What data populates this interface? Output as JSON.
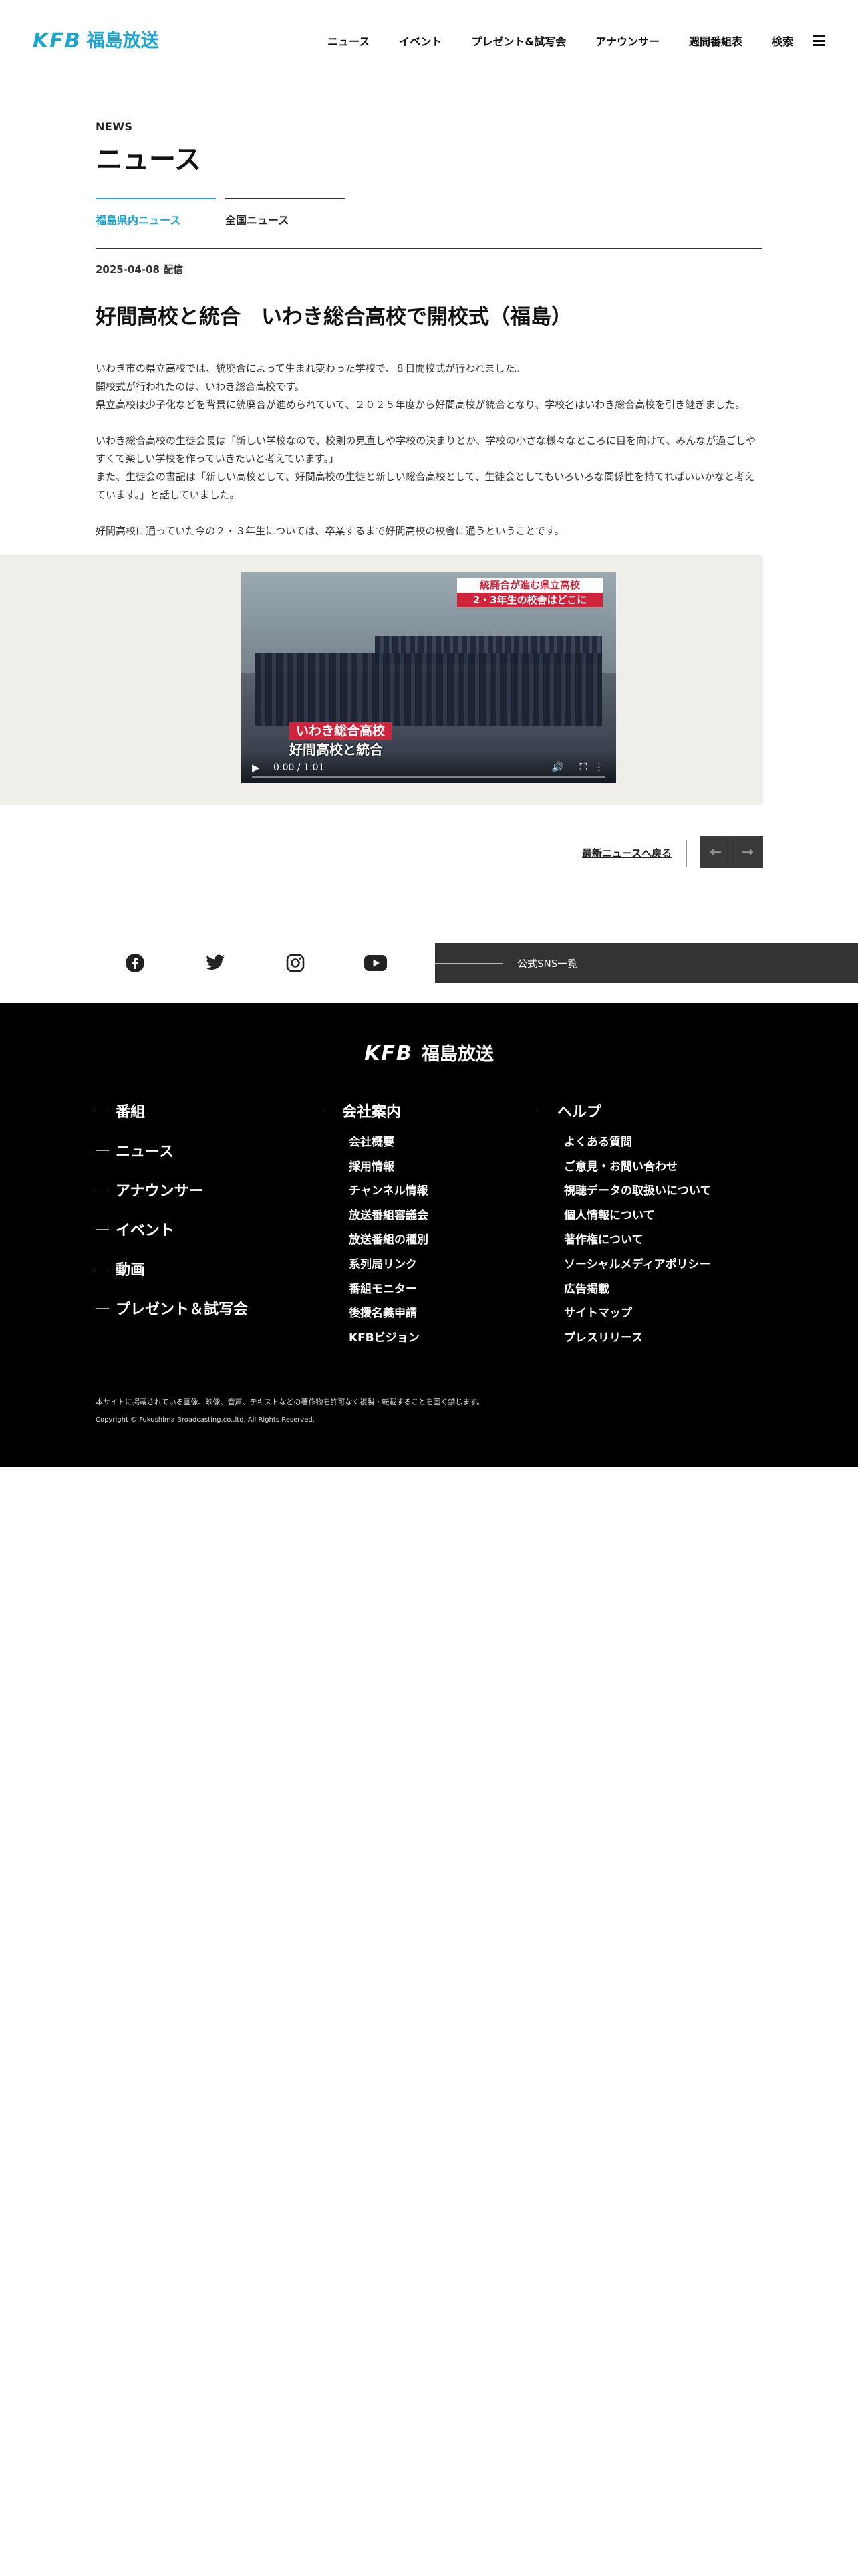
{
  "header": {
    "logo_mark": "KFB",
    "logo_name": "福島放送",
    "nav": [
      "ニュース",
      "イベント",
      "プレゼント&試写会",
      "アナウンサー",
      "週間番組表",
      "検索"
    ]
  },
  "page": {
    "eyebrow": "NEWS",
    "title": "ニュース",
    "tabs": [
      {
        "label": "福島県内ニュース",
        "active": true
      },
      {
        "label": "全国ニュース",
        "active": false
      }
    ]
  },
  "article": {
    "date": "2025-04-08 配信",
    "title": "好間高校と統合　いわき総合高校で開校式（福島）",
    "paragraphs": [
      [
        "いわき市の県立高校では、統廃合によって生まれ変わった学校で、８日開校式が行われました。",
        "開校式が行われたのは、いわき総合高校です。",
        "県立高校は少子化などを背景に統廃合が進められていて、２０２５年度から好間高校が統合となり、学校名はいわき総合高校を引き継ぎました。"
      ],
      [
        "いわき総合高校の生徒会長は「新しい学校なので、校則の見直しや学校の決まりとか、学校の小さな様々なところに目を向けて、みんなが過ごしやすくて楽しい学校を作っていきたいと考えています。」",
        "また、生徒会の書記は「新しい高校として、好間高校の生徒と新しい総合高校として、生徒会としてもいろいろな関係性を持てればいいかなと考えています。」と話していました。"
      ],
      [
        "好間高校に通っていた今の２・３年生については、卒業するまで好間高校の校舎に通うということです。"
      ]
    ]
  },
  "video": {
    "caption_top_1": "統廃合が進む県立高校",
    "caption_top_2": "2・3年生の校舎はどこに",
    "caption_bottom_1": "いわき総合高校",
    "caption_bottom_2": "好間高校と統合",
    "time": "0:00 / 1:01",
    "progress": 0
  },
  "pager": {
    "back_label": "最新ニュースへ戻る",
    "prev": "←",
    "next": "→"
  },
  "sns": {
    "list_label": "公式SNS一覧",
    "icons": [
      "facebook-icon",
      "twitter-icon",
      "instagram-icon",
      "youtube-icon"
    ]
  },
  "footer": {
    "logo_mark": "KFB",
    "logo_name": "福島放送",
    "col1": [
      "番組",
      "ニュース",
      "アナウンサー",
      "イベント",
      "動画",
      "プレゼント＆試写会"
    ],
    "col2_head": "会社案内",
    "col2": [
      "会社概要",
      "採用情報",
      "チャンネル情報",
      "放送番組審議会",
      "放送番組の種別",
      "系列局リンク",
      "番組モニター",
      "後援名義申請",
      "KFBビジョン"
    ],
    "col3_head": "ヘルプ",
    "col3": [
      "よくある質問",
      "ご意見・お問い合わせ",
      "視聴データの取扱いについて",
      "個人情報について",
      "著作権について",
      "ソーシャルメディアポリシー",
      "広告掲載",
      "サイトマップ",
      "プレスリリース"
    ],
    "note": "本サイトに掲載されている画像、映像、音声、テキストなどの著作物を許可なく複製・転載することを固く禁じます。",
    "copyright": "Copyright © Fukushima Broadcasting.co.,ltd. All Rights Reserved."
  },
  "colors": {
    "accent": "#1aa4cf",
    "footer_bg": "#000000",
    "video_band": "#efeee9",
    "caption_red": "#d0243c"
  }
}
